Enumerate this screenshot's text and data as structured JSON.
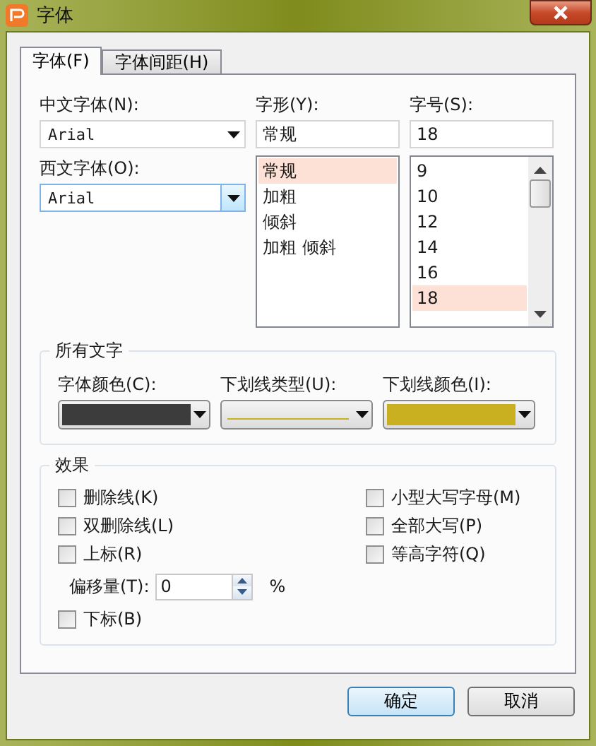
{
  "window": {
    "title": "字体"
  },
  "tabs": [
    {
      "label": "字体(F)",
      "selected": true
    },
    {
      "label": "字体间距(H)",
      "selected": false
    }
  ],
  "chinese_font": {
    "label": "中文字体(N):",
    "value": "Arial"
  },
  "western_font": {
    "label": "西文字体(O):",
    "value": "Arial",
    "focused": true
  },
  "style": {
    "label": "字形(Y):",
    "value": "常规",
    "options": [
      {
        "label": "常规",
        "selected": true
      },
      {
        "label": "加粗",
        "selected": false
      },
      {
        "label": "倾斜",
        "selected": false
      },
      {
        "label": "加粗 倾斜",
        "selected": false
      }
    ]
  },
  "size": {
    "label": "字号(S):",
    "value": "18",
    "options": [
      {
        "label": "9",
        "selected": false
      },
      {
        "label": "10",
        "selected": false
      },
      {
        "label": "12",
        "selected": false
      },
      {
        "label": "14",
        "selected": false
      },
      {
        "label": "16",
        "selected": false
      },
      {
        "label": "18",
        "selected": true
      }
    ]
  },
  "all_text": {
    "title": "所有文字",
    "font_color": {
      "label": "字体颜色(C):",
      "color": "#3c3c3c"
    },
    "underline_type": {
      "label": "下划线类型(U):"
    },
    "underline_color": {
      "label": "下划线颜色(I):",
      "color": "#c8b020"
    }
  },
  "effects": {
    "title": "效果",
    "left": [
      {
        "label": "删除线(K)",
        "checked": false
      },
      {
        "label": "双删除线(L)",
        "checked": false
      },
      {
        "label": "上标(R)",
        "checked": false
      }
    ],
    "offset": {
      "label": "偏移量(T):",
      "value": "0",
      "unit": "%"
    },
    "below": [
      {
        "label": "下标(B)",
        "checked": false
      }
    ],
    "right": [
      {
        "label": "小型大写字母(M)",
        "checked": false
      },
      {
        "label": "全部大写(P)",
        "checked": false
      },
      {
        "label": "等高字符(Q)",
        "checked": false
      }
    ]
  },
  "buttons": [
    {
      "label": "确定",
      "default": true
    },
    {
      "label": "取消",
      "default": false
    }
  ]
}
